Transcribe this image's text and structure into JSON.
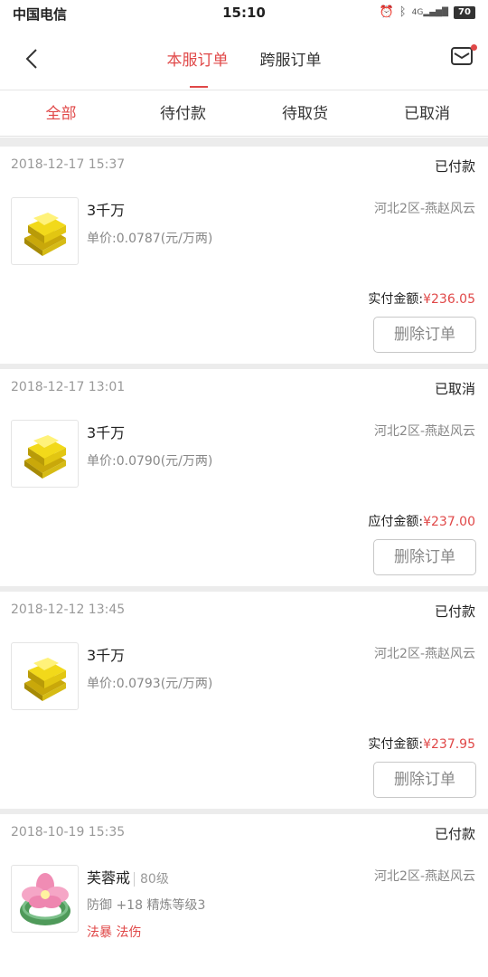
{
  "status_bar": {
    "carrier": "中国电信",
    "time": "15:10",
    "battery": "70",
    "network": "4G"
  },
  "nav": {
    "tabs": [
      {
        "label": "本服订单",
        "active": true
      },
      {
        "label": "跨服订单",
        "active": false
      }
    ]
  },
  "filters": [
    {
      "label": "全部",
      "active": true
    },
    {
      "label": "待付款",
      "active": false
    },
    {
      "label": "待取货",
      "active": false
    },
    {
      "label": "已取消",
      "active": false
    }
  ],
  "orders": [
    {
      "date": "2018-12-17 15:37",
      "status": "已付款",
      "item": "3千万",
      "server": "河北2区-燕赵风云",
      "unit_price": "单价:0.0787(元/万两)",
      "amount_label": "实付金额:",
      "amount": "¥236.05",
      "button": "删除订单",
      "icon": "gold-bars-icon"
    },
    {
      "date": "2018-12-17 13:01",
      "status": "已取消",
      "item": "3千万",
      "server": "河北2区-燕赵风云",
      "unit_price": "单价:0.0790(元/万两)",
      "amount_label": "应付金额:",
      "amount": "¥237.00",
      "button": "删除订单",
      "icon": "gold-bars-icon"
    },
    {
      "date": "2018-12-12 13:45",
      "status": "已付款",
      "item": "3千万",
      "server": "河北2区-燕赵风云",
      "unit_price": "单价:0.0793(元/万两)",
      "amount_label": "实付金额:",
      "amount": "¥237.95",
      "button": "删除订单",
      "icon": "gold-bars-icon"
    },
    {
      "date": "2018-10-19 15:35",
      "status": "已付款",
      "item": "芙蓉戒",
      "level": "80级",
      "server": "河北2区-燕赵风云",
      "attributes": "防御 +18 精炼等级3",
      "special": "法暴 法伤",
      "icon": "lotus-ring-icon"
    }
  ],
  "colors": {
    "accent": "#e04848",
    "divider": "#ececec",
    "gold": "#f2d91a"
  }
}
